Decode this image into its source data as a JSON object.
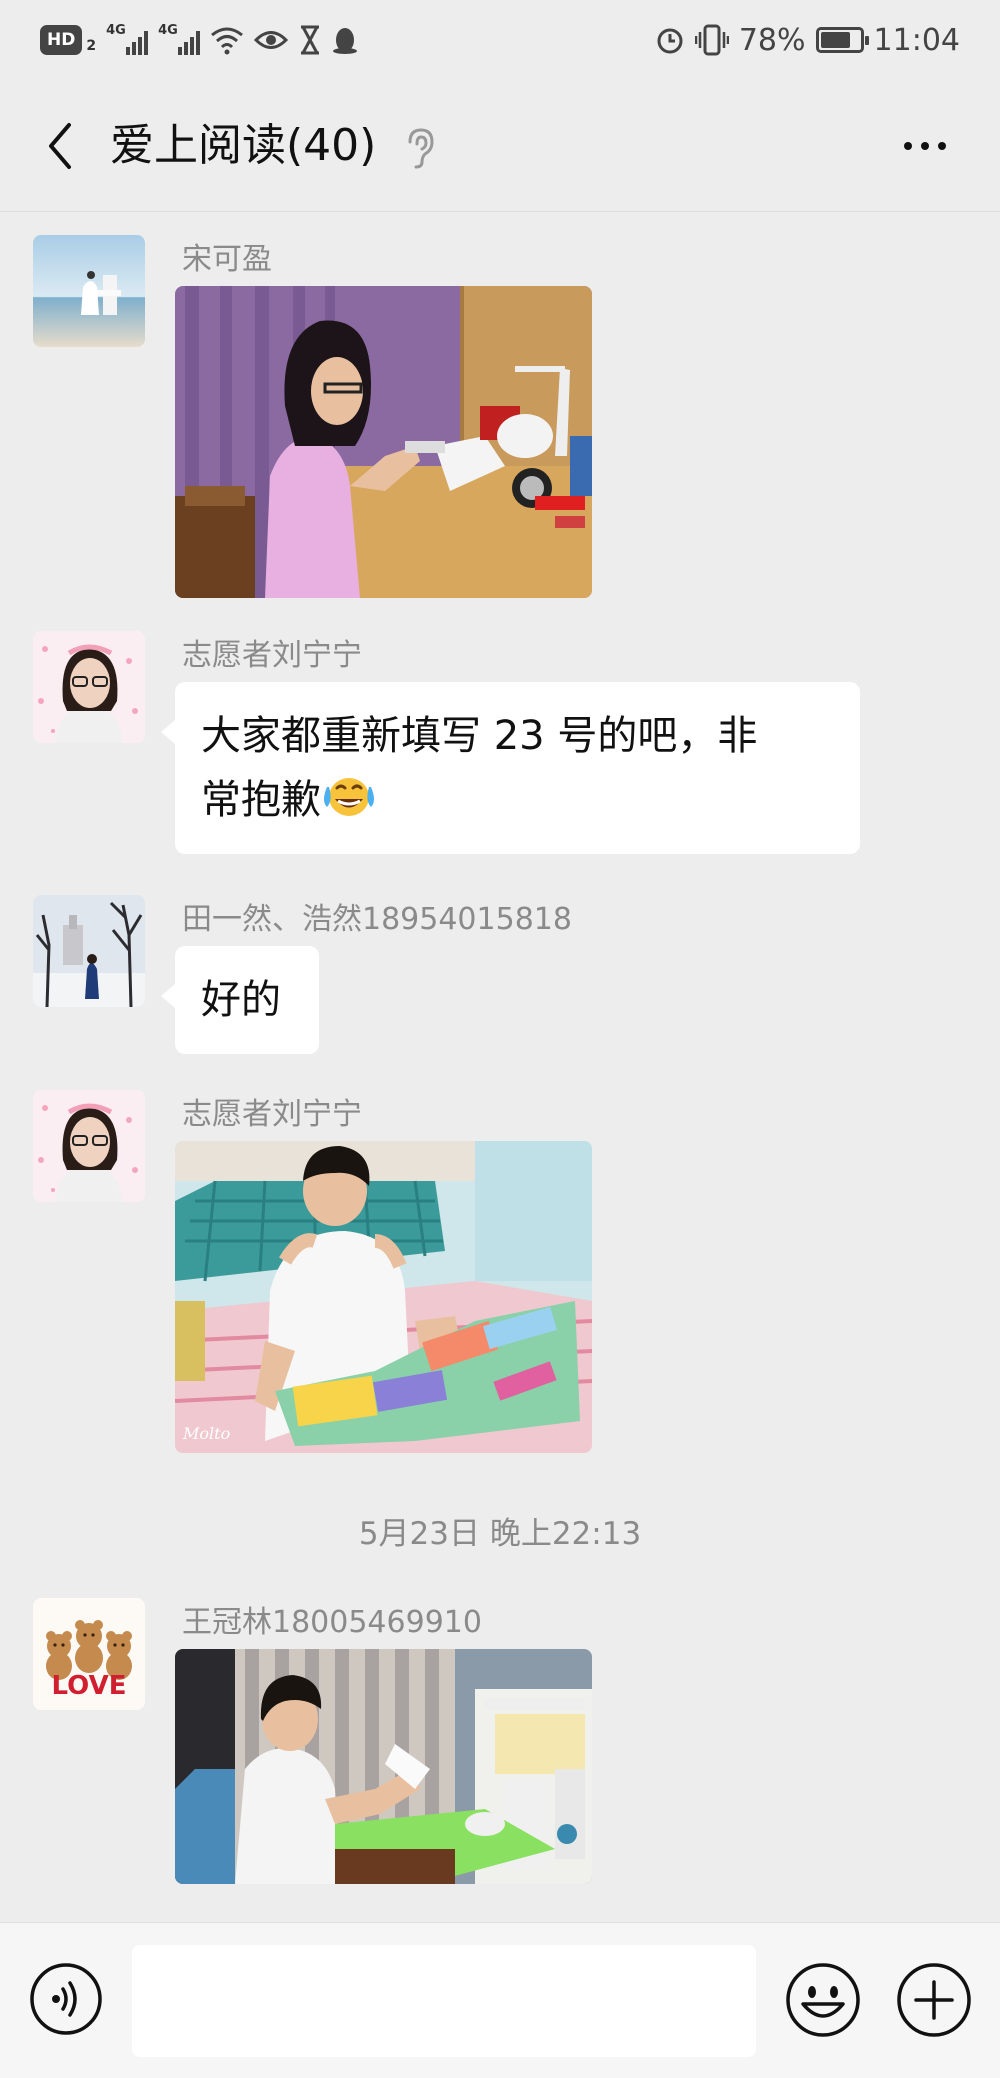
{
  "status_bar": {
    "hd": "HD",
    "sim2": "2",
    "net1": "4G",
    "net2": "4G",
    "battery_percent": "78%",
    "battery_level": 0.78,
    "time": "11:04"
  },
  "header": {
    "title": "爱上阅读(40)"
  },
  "messages": [
    {
      "sender": "宋可盈",
      "type": "image"
    },
    {
      "sender": "志愿者刘宁宁",
      "type": "text",
      "text_line1": "大家都重新填写 23 号的吧，非",
      "text_line2": "常抱歉"
    },
    {
      "sender": "田一然、浩然18954015818",
      "type": "text",
      "text": "好的"
    },
    {
      "sender": "志愿者刘宁宁",
      "type": "image",
      "watermark": "Molto"
    }
  ],
  "timestamp": "5月23日 晚上22:13",
  "messages_after": [
    {
      "sender": "王冠林18005469910",
      "type": "image",
      "avatar_text": "LOVE"
    }
  ],
  "input": {
    "value": "",
    "placeholder": ""
  },
  "icons": {
    "back": "back-arrow-icon",
    "ear": "ear-icon",
    "more": "more-icon",
    "voice": "voice-icon",
    "emoji": "emoji-icon",
    "plus": "plus-icon",
    "laugh_emoji": "tears-of-joy-emoji"
  }
}
